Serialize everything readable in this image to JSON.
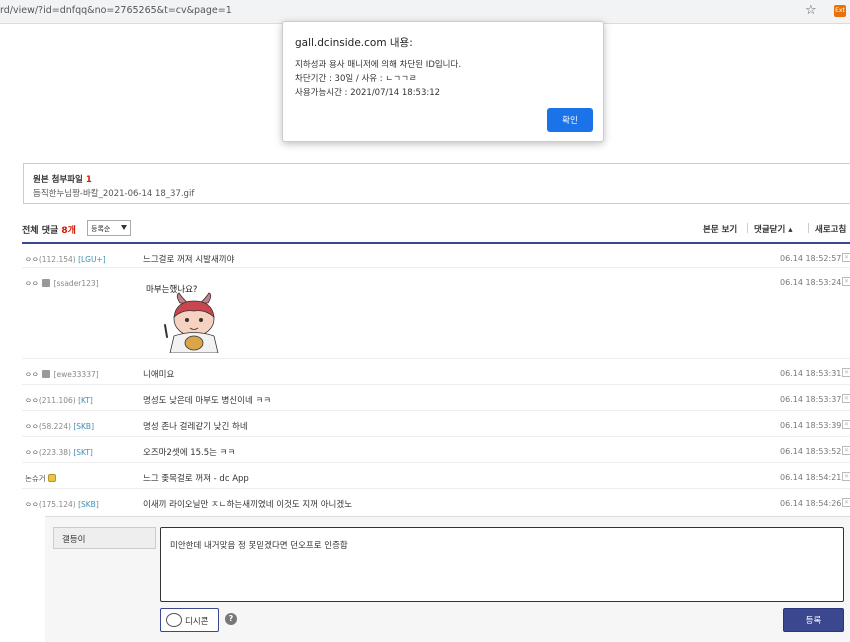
{
  "browser": {
    "url": "rd/view/?id=dnfqq&no=2765265&t=cv&page=1",
    "star_icon": "star-icon",
    "extension_label": "Ext"
  },
  "dialog": {
    "title": "gall.dcinside.com 내용:",
    "line1": "지하성과 용사 매니저에 의해 차단된 ID입니다.",
    "line2": "차단기간 : 30일 / 사유 : ㄴㄱㄱㄹ",
    "line3": "사용가능시간 : 2021/07/14 18:53:12",
    "ok_label": "확인"
  },
  "attachment": {
    "title": "원본 첨부파일",
    "count": "1",
    "filename": "듬직한누님짱-바칼_2021-06-14 18_37.gif"
  },
  "comments_header": {
    "label": "전체 댓글",
    "count": "8개",
    "sort": "등록순",
    "view_post": "본문 보기",
    "close_comments": "댓글닫기 ▴",
    "refresh": "새로고침"
  },
  "comments": [
    {
      "nick": "ㅇㅇ",
      "ip": "(112.154)",
      "isp": "[LGU+]",
      "text": "느그걸로 꺼져 시발새끼야",
      "date": "06.14 18:52:57"
    },
    {
      "nick": "ㅇㅇ",
      "ip": "",
      "isp": "[ssader123]",
      "text": "마부는했나요?",
      "date": "06.14 18:53:24"
    },
    {
      "nick": "ㅇㅇ",
      "ip": "",
      "isp": "[ewe33337]",
      "text": "니애미요",
      "date": "06.14 18:53:31"
    },
    {
      "nick": "ㅇㅇ",
      "ip": "(211.106)",
      "isp": "[KT]",
      "text": "명성도 낮은데 마부도 병신이네 ㅋㅋ",
      "date": "06.14 18:53:37"
    },
    {
      "nick": "ㅇㅇ",
      "ip": "(58.224)",
      "isp": "[SKB]",
      "text": "명성 존나 걸레같기 낮긴 하네",
      "date": "06.14 18:53:39"
    },
    {
      "nick": "ㅇㅇ",
      "ip": "(223.38)",
      "isp": "[SKT]",
      "text": "오즈마2셋에 15.5는 ㅋㅋ",
      "date": "06.14 18:53:52"
    },
    {
      "nick": "논슈거",
      "ip": "",
      "isp": "",
      "text": "느그 좆목걸로 꺼져 - dc App",
      "date": "06.14 18:54:21"
    },
    {
      "nick": "ㅇㅇ",
      "ip": "(175.124)",
      "isp": "[SKB]",
      "text": "이새끼 라이오닐만 ㅈㄴ하는새끼였네 이것도 지꺼 아니겠노",
      "date": "06.14 18:54:26"
    }
  ],
  "reply": {
    "nickname": "갤등이",
    "text": "미안한데 내거맞음 정 못믿겠다면 던오프로 인증함",
    "dccon_label": "디시콘",
    "help": "?",
    "submit_label": "등록"
  },
  "colors": {
    "accent": "#3b4890",
    "dialog_button": "#1a73e8",
    "count_red": "#d31900",
    "isp_blue": "#3d8eb9"
  }
}
